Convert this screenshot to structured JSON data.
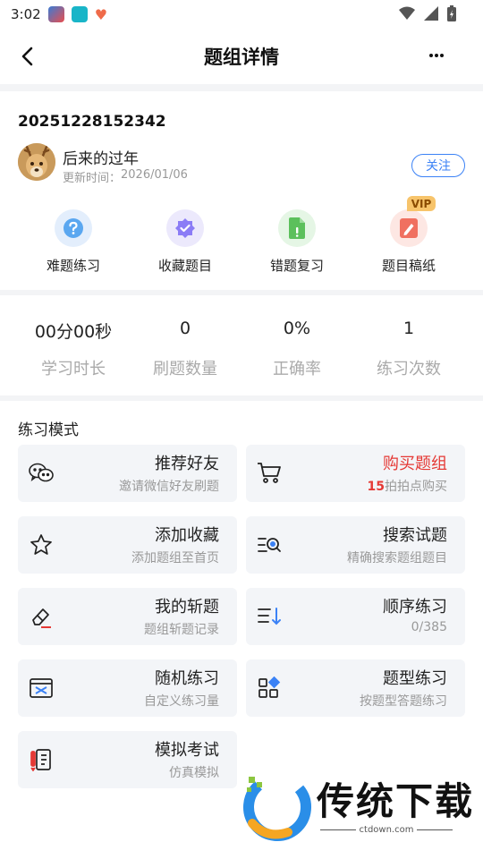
{
  "status_bar": {
    "time": "3:02"
  },
  "header": {
    "title": "题组详情"
  },
  "info": {
    "group_id": "20251228152342",
    "author": "后来的过年",
    "update_label": "更新时间：",
    "update_date": "2026/01/06",
    "follow_label": "关注"
  },
  "quick_actions": [
    {
      "label": "难题练习",
      "icon": "question-icon",
      "color": "#5aa7f0"
    },
    {
      "label": "收藏题目",
      "icon": "favorite-badge-icon",
      "color": "#8b7cf6"
    },
    {
      "label": "错题复习",
      "icon": "error-doc-icon",
      "color": "#5cc05c"
    },
    {
      "label": "题目稿纸",
      "icon": "draft-paper-icon",
      "color": "#f07060"
    }
  ],
  "vip_badge": "VIP",
  "stats": [
    {
      "value": "00分00秒",
      "label": "学习时长"
    },
    {
      "value": "0",
      "label": "刷题数量"
    },
    {
      "value": "0%",
      "label": "正确率"
    },
    {
      "value": "1",
      "label": "练习次数"
    }
  ],
  "practice": {
    "section_title": "练习模式",
    "cards": [
      {
        "title": "推荐好友",
        "sub": "邀请微信好友刷题",
        "icon": "wechat-icon"
      },
      {
        "title": "购买题组",
        "sub_num": "15",
        "sub": "拍拍点购买",
        "icon": "cart-icon"
      },
      {
        "title": "添加收藏",
        "sub": "添加题组至首页",
        "icon": "star-icon"
      },
      {
        "title": "搜索试题",
        "sub": "精确搜索题组题目",
        "icon": "search-list-icon"
      },
      {
        "title": "我的斩题",
        "sub": "题组斩题记录",
        "icon": "eraser-icon"
      },
      {
        "title": "顺序练习",
        "sub": "0/385",
        "icon": "sort-order-icon"
      },
      {
        "title": "随机练习",
        "sub": "自定义练习量",
        "icon": "shuffle-icon"
      },
      {
        "title": "题型练习",
        "sub": "按题型答题练习",
        "icon": "grid-shapes-icon"
      },
      {
        "title": "模拟考试",
        "sub": "仿真模拟",
        "icon": "exam-notebook-icon"
      }
    ]
  },
  "watermark": {
    "text": "传统下载",
    "url": "ctdown.com"
  }
}
